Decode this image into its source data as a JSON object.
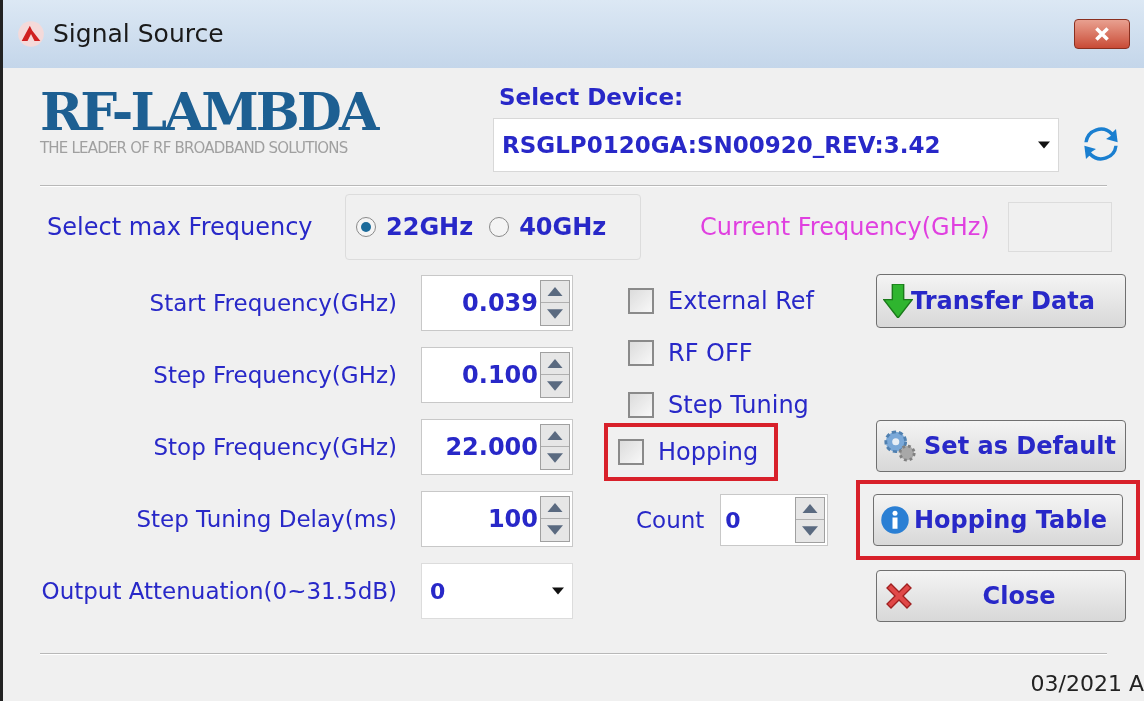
{
  "window": {
    "title": "Signal Source"
  },
  "logo": {
    "name": "RF-LAMBDA",
    "tagline": "THE LEADER OF RF BROADBAND SOLUTIONS"
  },
  "device": {
    "label": "Select Device:",
    "value": "RSGLP0120GA:SN00920_REV:3.42"
  },
  "max_frequency": {
    "label": "Select max Frequency",
    "options": [
      {
        "label": "22GHz",
        "selected": true
      },
      {
        "label": "40GHz",
        "selected": false
      }
    ]
  },
  "current_frequency": {
    "label": "Current Frequency(GHz)"
  },
  "fields": [
    {
      "label": "Start Frequency(GHz)",
      "value": "0.039",
      "kind": "spin"
    },
    {
      "label": "Step Frequency(GHz)",
      "value": "0.100",
      "kind": "spin"
    },
    {
      "label": "Stop Frequency(GHz)",
      "value": "22.000",
      "kind": "spin"
    },
    {
      "label": "Step Tuning Delay(ms)",
      "value": "100",
      "kind": "spin"
    },
    {
      "label": "Output Attenuation(0~31.5dB)",
      "value": "0",
      "kind": "dropdown"
    }
  ],
  "checkboxes": [
    {
      "label": "External Ref",
      "checked": false,
      "highlighted": false
    },
    {
      "label": "RF OFF",
      "checked": false,
      "highlighted": false
    },
    {
      "label": "Step Tuning",
      "checked": false,
      "highlighted": false
    },
    {
      "label": "Hopping",
      "checked": false,
      "highlighted": true
    }
  ],
  "count": {
    "label": "Count",
    "value": "0"
  },
  "buttons": [
    {
      "label": "Transfer Data",
      "kind": "download",
      "highlighted": false
    },
    {
      "label": "Set as Default",
      "kind": "gear",
      "highlighted": false
    },
    {
      "label": "Hopping Table",
      "kind": "info",
      "highlighted": true
    },
    {
      "label": "Close",
      "kind": "close",
      "highlighted": false
    }
  ],
  "footer": "03/2021 A"
}
